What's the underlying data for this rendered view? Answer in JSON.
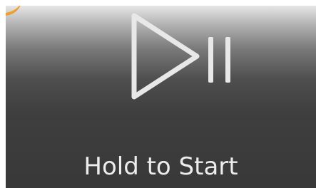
{
  "control": {
    "icon": "play-pause-icon",
    "hint_text": "Hold to Start"
  },
  "colors": {
    "icon": "#e8e8e8",
    "text": "#ededed",
    "accent": "#f0a028"
  }
}
